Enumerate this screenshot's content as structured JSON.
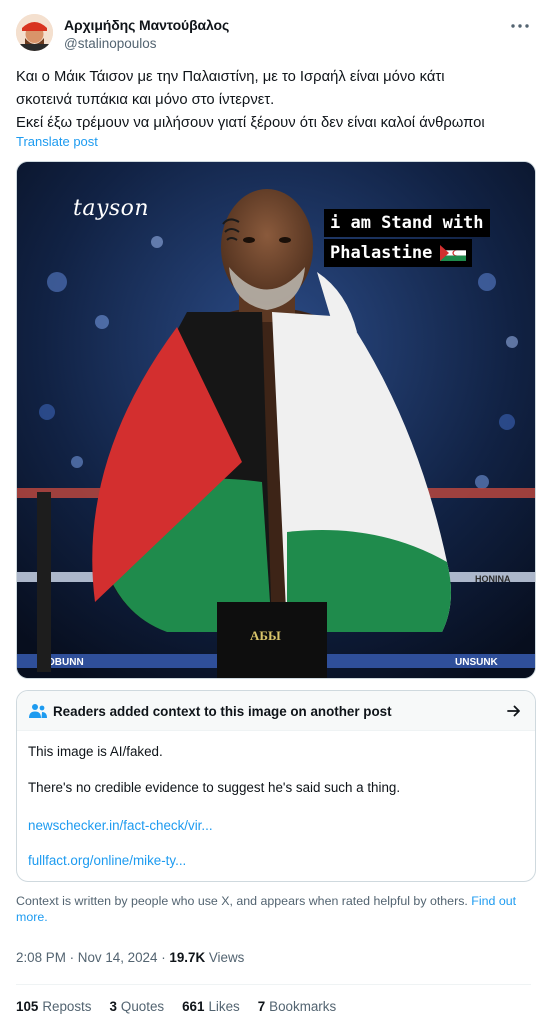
{
  "author": {
    "name": "Αρχιμήδης Μαντούβαλος",
    "handle": "@stalinopoulos"
  },
  "post": {
    "lines": [
      "Και ο Μάικ Τάισον με την Παλαιστίνη, με το Ισραήλ είναι μόνο κάτι",
      "σκοτεινά τυπάκια και μόνο στο ίντερνετ.",
      "Εκεί έξω τρέμουν να μιλήσουν γιατί ξέρουν ότι δεν είναι καλοί άνθρωποι"
    ],
    "translate_label": "Translate post"
  },
  "image": {
    "overlay_signature": "tayson",
    "overlay_caption_line1": "i am Stand with",
    "overlay_caption_line2": "Phalastine",
    "flag_emoji_icon": "western-sahara-flag-icon",
    "trunks_text": "АБЫ",
    "ring_text_left": "OBUNN",
    "ring_text_right": "UNSUNK",
    "ring_text_side": "HONINA"
  },
  "community_note": {
    "header": "Readers added context to this image on another post",
    "line1": "This image is AI/faked.",
    "line2": "There's no credible evidence to suggest he's said such a thing.",
    "link1": "newschecker.in/fact-check/vir...",
    "link2": "fullfact.org/online/mike-ty...",
    "icon": "people-icon",
    "arrow_icon": "arrow-right-icon"
  },
  "disclaimer": {
    "text": "Context is written by people who use X, and appears when rated helpful by others.",
    "link": "Find out more."
  },
  "meta": {
    "time": "2:08 PM",
    "date": "Nov 14, 2024",
    "views_count": "19.7K",
    "views_label": "Views"
  },
  "stats": [
    {
      "count": "105",
      "label": "Reposts"
    },
    {
      "count": "3",
      "label": "Quotes"
    },
    {
      "count": "661",
      "label": "Likes"
    },
    {
      "count": "7",
      "label": "Bookmarks"
    }
  ],
  "colors": {
    "link": "#1d9bf0",
    "secondary_text": "#536471",
    "flag_red": "#d32f2f",
    "flag_green": "#1f8b4c"
  }
}
